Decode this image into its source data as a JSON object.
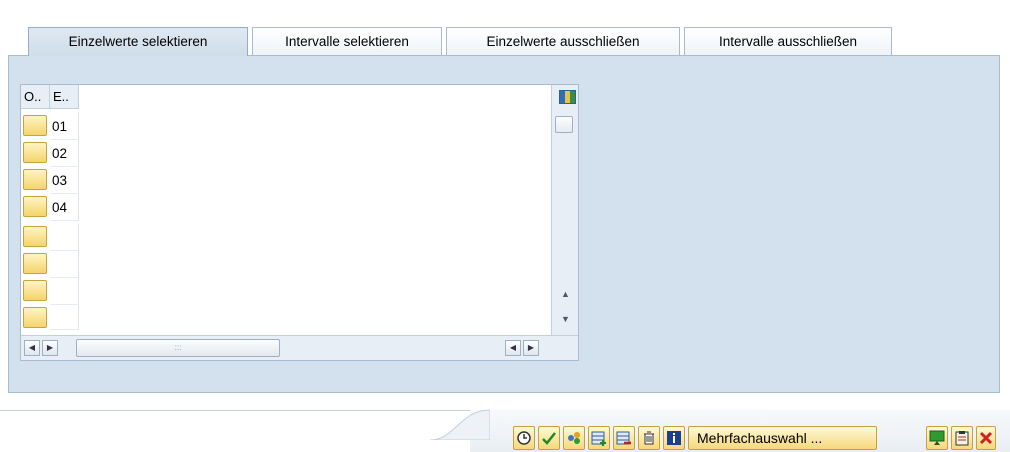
{
  "tabs": [
    {
      "label": "Einzelwerte selektieren",
      "active": true
    },
    {
      "label": "Intervalle selektieren",
      "active": false
    },
    {
      "label": "Einzelwerte ausschließen",
      "active": false
    },
    {
      "label": "Intervalle ausschließen",
      "active": false
    }
  ],
  "grid": {
    "columns": [
      "O..",
      "E.."
    ],
    "rows": [
      "01",
      "02",
      "03",
      "04",
      "",
      "",
      "",
      ""
    ],
    "scroll_up": "▲",
    "scroll_down": "▼",
    "hscroll_grip": ":::",
    "left_arrow": "◀",
    "right_arrow": "▶"
  },
  "toolbar": {
    "multi_select_label": "Mehrfachauswahl ...",
    "icons": [
      "execute-icon",
      "check-icon",
      "variants-icon",
      "insert-row-icon",
      "delete-row-icon",
      "trash-icon",
      "info-icon",
      "import-icon",
      "clipboard-icon",
      "cancel-icon"
    ]
  },
  "colors": {
    "accent_yellow": "#f4d46c",
    "panel_blue": "#d3e1ee"
  }
}
